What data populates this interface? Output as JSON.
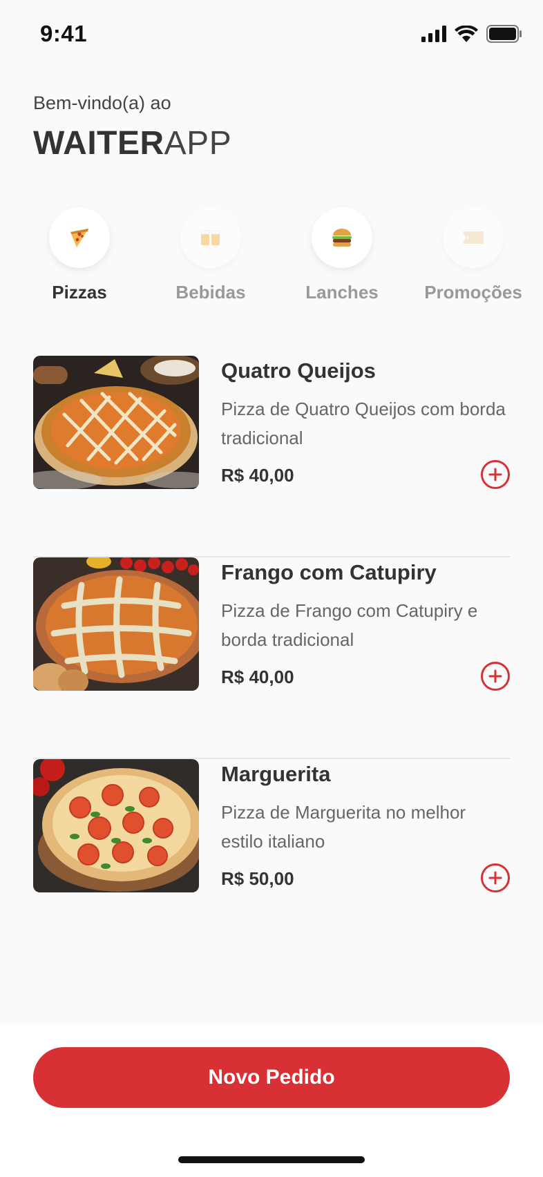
{
  "status_bar": {
    "time": "9:41"
  },
  "header": {
    "welcome": "Bem-vindo(a) ao",
    "brand_strong": "WAITER",
    "brand_light": "APP"
  },
  "categories": [
    {
      "label": "Pizzas",
      "icon": "pizza-icon",
      "active": true
    },
    {
      "label": "Bebidas",
      "icon": "beer-icon",
      "active": false
    },
    {
      "label": "Lanches",
      "icon": "burger-icon",
      "active": false
    },
    {
      "label": "Promoções",
      "icon": "tag-icon",
      "active": false
    }
  ],
  "products": [
    {
      "name": "Quatro Queijos",
      "description": "Pizza de Quatro Queijos com borda tradicional",
      "price": "R$ 40,00"
    },
    {
      "name": "Frango com Catupiry",
      "description": "Pizza de Frango com Catupiry e borda tradicional",
      "price": "R$ 40,00"
    },
    {
      "name": "Marguerita",
      "description": "Pizza de Marguerita no melhor estilo italiano",
      "price": "R$ 50,00"
    }
  ],
  "footer": {
    "order_button": "Novo Pedido"
  },
  "colors": {
    "accent": "#d73035",
    "text": "#333333",
    "muted": "#999999",
    "background": "#fafafa"
  }
}
